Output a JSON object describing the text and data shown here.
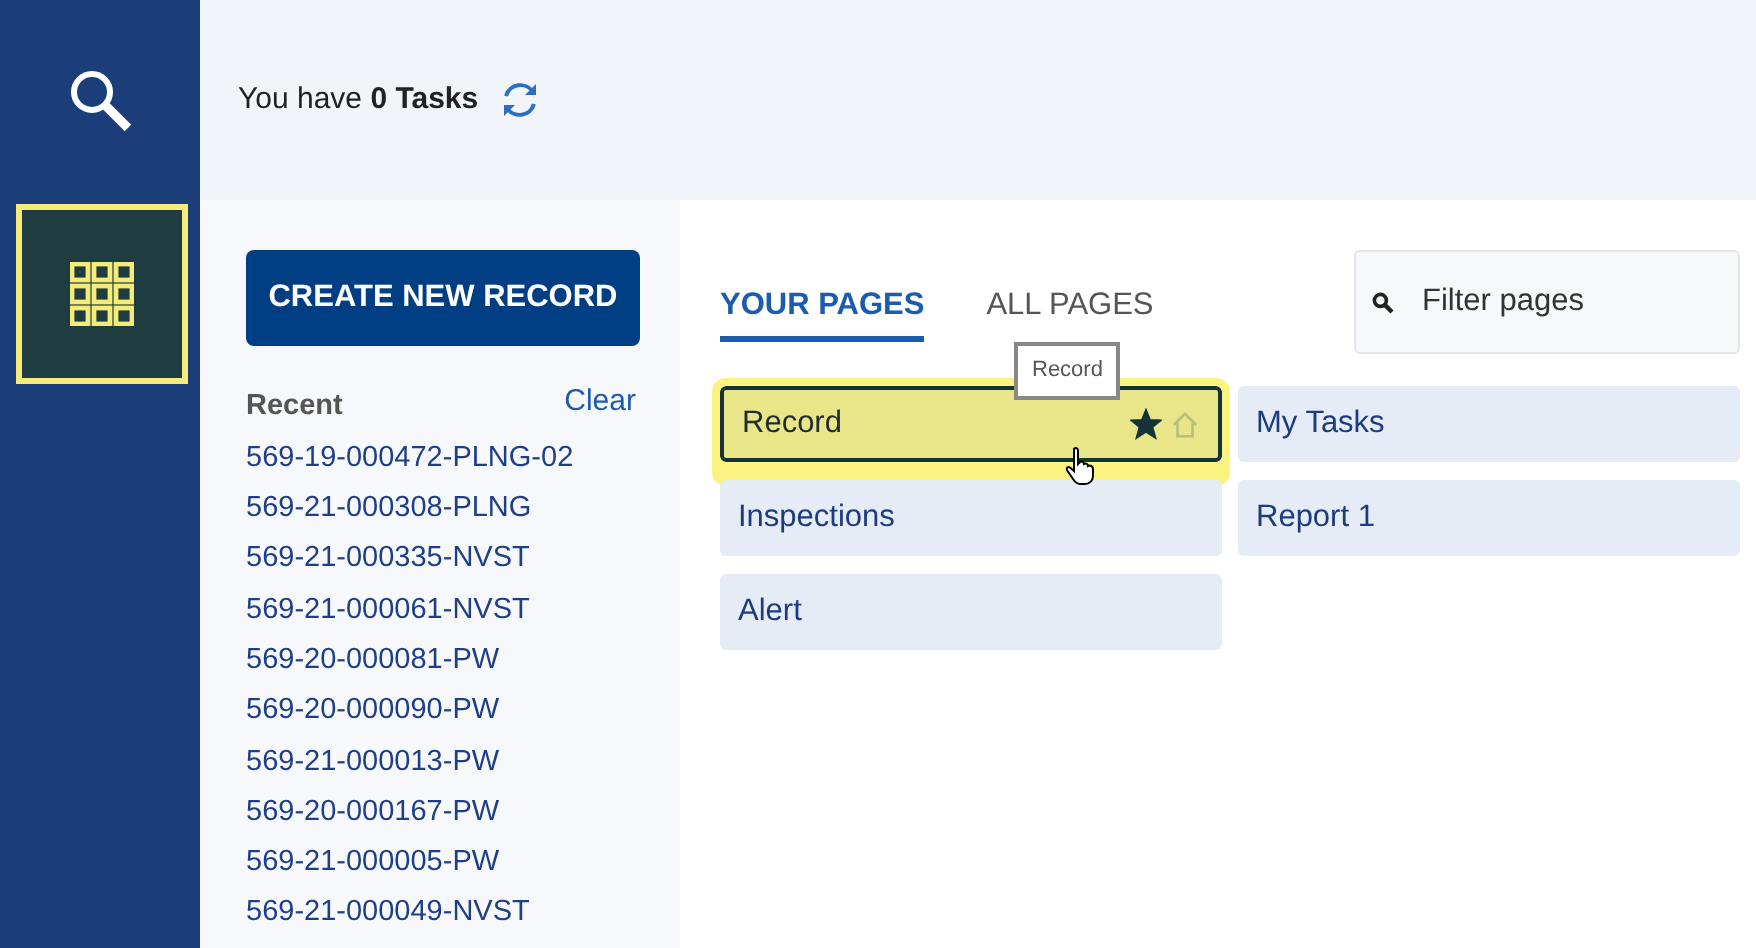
{
  "tasks": {
    "prefix": "You have",
    "count": "0",
    "suffix": "Tasks"
  },
  "rail": [
    {
      "kind": "search",
      "selected": false
    },
    {
      "kind": "apps",
      "selected": true
    }
  ],
  "create_button": "CREATE NEW RECORD",
  "recent": {
    "title": "Recent",
    "clear": "Clear",
    "items": [
      "569-19-000472-PLNG-02",
      "569-21-000308-PLNG",
      "569-21-000335-NVST",
      "569-21-000061-NVST",
      "569-20-000081-PW",
      "569-20-000090-PW",
      "569-21-000013-PW",
      "569-20-000167-PW",
      "569-21-000005-PW",
      "569-21-000049-NVST"
    ]
  },
  "tabs": [
    {
      "label": "YOUR PAGES",
      "selected": true
    },
    {
      "label": "ALL PAGES",
      "selected": false
    }
  ],
  "filter": {
    "placeholder": "Filter pages"
  },
  "tooltip": "Record",
  "pages": [
    {
      "label": "Record",
      "highlighted": true,
      "icons": {
        "favorite": true,
        "home": false
      }
    },
    {
      "label": "My Tasks",
      "highlighted": false
    },
    {
      "label": "Inspections",
      "highlighted": false
    },
    {
      "label": "Report 1",
      "highlighted": false
    },
    {
      "label": "Alert",
      "highlighted": false
    }
  ]
}
